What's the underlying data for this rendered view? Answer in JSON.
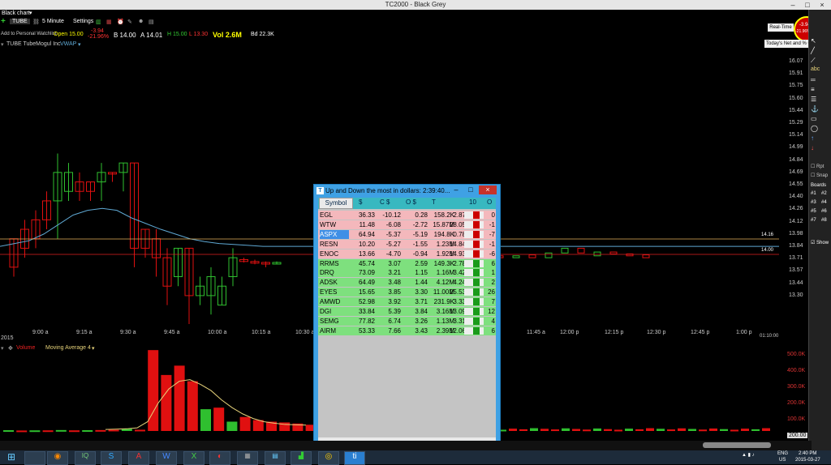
{
  "window": {
    "title": "TC2000 - Black Grey"
  },
  "menubar": {
    "label": "Black chart"
  },
  "toolbar": {
    "symbol": "TUBE",
    "interval": "5 Minute",
    "settings": "Settings"
  },
  "watchlist": {
    "label": "Add to Personal Watchlist"
  },
  "quote": {
    "open": "Open 15.00",
    "change": "-3.94",
    "change_pct": "-21.96%",
    "bid": "B 14.00",
    "ask": "A 14.01",
    "high": "H 15.00",
    "low": "L 13.30",
    "vol": "Vol 2.6M",
    "bidsize": "Bd 22.3K"
  },
  "chart_label": {
    "symbol": "TUBE TubeMogul Inc",
    "indicator": "VWAP"
  },
  "right_header": {
    "realtime": "Real-Time",
    "badge_change": "-3.94",
    "badge_pct": "-21.96%",
    "tooltip": "Today's Net and % Change"
  },
  "price_axis": [
    "16.07",
    "15.91",
    "15.75",
    "15.60",
    "15.44",
    "15.29",
    "15.14",
    "14.99",
    "14.84",
    "14.69",
    "14.55",
    "14.40",
    "14.26",
    "14.12",
    "13.98",
    "13.84",
    "13.71",
    "13.57",
    "13.44",
    "13.30"
  ],
  "price_markers": [
    "14.16",
    "14.00"
  ],
  "time_axis": [
    "9:00 a",
    "9:15 a",
    "9:30 a",
    "9:45 a",
    "10:00 a",
    "10:15 a",
    "10:30 a",
    "11:45 a",
    "12:00 p",
    "12:15 p",
    "12:30 p",
    "12:45 p",
    "1:00 p"
  ],
  "year_label": "2015",
  "timer": "01:10:00",
  "volume": {
    "label": "Volume",
    "ma_label": "Moving Average 4",
    "axis": [
      "500.0K",
      "400.0K",
      "300.0K",
      "200.0K",
      "100.0K"
    ],
    "last": "200.00"
  },
  "popup": {
    "title": "Up and Down the most in dollars:  2:39:40...",
    "headers": [
      "Symbol",
      "$",
      "C $",
      "O $",
      "T",
      "",
      "10",
      "O"
    ],
    "rows": [
      {
        "sym": "EGL",
        "a": "36.33",
        "b": "-10.12",
        "c": "0.28",
        "d": "158.2K",
        "e": "2.87",
        "f": "0",
        "up": false
      },
      {
        "sym": "WTW",
        "a": "11.48",
        "b": "-6.08",
        "c": "-2.72",
        "d": "15.87M",
        "e": "28.05",
        "f": "-1",
        "up": false
      },
      {
        "sym": "ASPX",
        "a": "64.94",
        "b": "-5.37",
        "c": "-5.19",
        "d": "194.8K",
        "e": "0.78",
        "f": "-7",
        "up": false,
        "sel": true
      },
      {
        "sym": "RESN",
        "a": "10.20",
        "b": "-5.27",
        "c": "-1.55",
        "d": "1.23M",
        "e": "14.84",
        "f": "-1",
        "up": false
      },
      {
        "sym": "ENOC",
        "a": "13.66",
        "b": "-4.70",
        "c": "-0.94",
        "d": "1.92M",
        "e": "14.93",
        "f": "-6",
        "up": false
      },
      {
        "sym": "RRMS",
        "a": "45.74",
        "b": "3.07",
        "c": "2.59",
        "d": "149.3K",
        "e": "2.78",
        "f": "6",
        "up": true
      },
      {
        "sym": "DRQ",
        "a": "73.09",
        "b": "3.21",
        "c": "1.15",
        "d": "1.16M",
        "e": "3.42",
        "f": "1",
        "up": true
      },
      {
        "sym": "ADSK",
        "a": "64.49",
        "b": "3.48",
        "c": "1.44",
        "d": "4.12M",
        "e": "4.24",
        "f": "2",
        "up": true
      },
      {
        "sym": "EYES",
        "a": "15.65",
        "b": "3.85",
        "c": "3.30",
        "d": "11.00M",
        "e": "25.53",
        "f": "26",
        "up": true
      },
      {
        "sym": "AMWD",
        "a": "52.98",
        "b": "3.92",
        "c": "3.71",
        "d": "231.9K",
        "e": "3.33",
        "f": "7",
        "up": true
      },
      {
        "sym": "DGI",
        "a": "33.84",
        "b": "5.39",
        "c": "3.84",
        "d": "3.16M",
        "e": "13.09",
        "f": "12",
        "up": true
      },
      {
        "sym": "SEMG",
        "a": "77.82",
        "b": "6.74",
        "c": "3.26",
        "d": "1.13M",
        "e": "3.31",
        "f": "4",
        "up": true
      },
      {
        "sym": "AIRM",
        "a": "53.33",
        "b": "7.66",
        "c": "3.43",
        "d": "2.39M",
        "e": "12.06",
        "f": "6",
        "up": true
      }
    ]
  },
  "right_panel": {
    "rpt": "Rpt",
    "snap": "Snap",
    "boards": "Boards",
    "board_items": [
      "#1",
      "#2",
      "#3",
      "#4",
      "#5",
      "#6",
      "#7",
      "#8"
    ],
    "show": "Show"
  },
  "tray": {
    "lang": "ENG",
    "region": "US",
    "time": "2:40 PM",
    "date": "2015-03-27"
  },
  "colors": {
    "up": "#2fbf2f",
    "down": "#e01010",
    "vwap": "#5fa8d3",
    "ma": "#e6d27a",
    "row_down": "#f4b8bc",
    "row_up": "#7ee07e",
    "selected": "#3f8fe6"
  }
}
